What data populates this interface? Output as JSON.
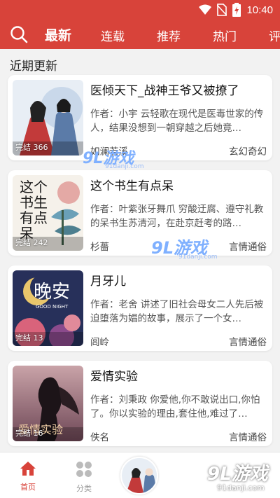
{
  "status_bar": {
    "time": "10:40"
  },
  "top_nav": {
    "tabs": [
      {
        "label": "最新",
        "active": true
      },
      {
        "label": "连载",
        "active": false
      },
      {
        "label": "推荐",
        "active": false
      },
      {
        "label": "热门",
        "active": false
      },
      {
        "label": "评",
        "active": false
      }
    ]
  },
  "section": {
    "title": "近期更新"
  },
  "books": [
    {
      "title": "医倾天下_战神王爷又被撩了",
      "desc": "作者：小宇 云轻歌在现代是医毒世家的传人，结果没想到一朝穿越之后她竟…",
      "author": "如澜若溪",
      "genre": "玄幻奇幻",
      "badge": "完结 366"
    },
    {
      "title": "这个书生有点呆",
      "desc": "作者：叶紫张牙舞爪 穷酸迂腐、遵守礼教的呆书生苏清河，在赴京赶考的路…",
      "author": "杉薔",
      "genre": "言情通俗",
      "badge": "完结 242"
    },
    {
      "title": "月牙儿",
      "desc": "作者：老舍 讲述了旧社会母女二人先后被迫堕落为娼的故事，展示了一个女…",
      "author": "闾岭",
      "genre": "言情通俗",
      "badge": "完结 13"
    },
    {
      "title": "爱情实验",
      "desc": "作者：刘秉政 你爱他,你不敢说出口,你怕了。你以实验的理由,套住他,难过了…",
      "author": "佚名",
      "genre": "言情通俗",
      "badge": "完结 16"
    }
  ],
  "covers": {
    "c3_text": "晚安",
    "c3_sub": "GOOD NIGHT",
    "c4_text": "爱情实验",
    "c2_text": "这个书生有点呆"
  },
  "bottom_nav": {
    "home_label": "首页",
    "category_label": "分类"
  },
  "watermarks": {
    "text": "9L游戏",
    "url": "91danji.com"
  },
  "colors": {
    "brand_red": "#d8433a"
  }
}
